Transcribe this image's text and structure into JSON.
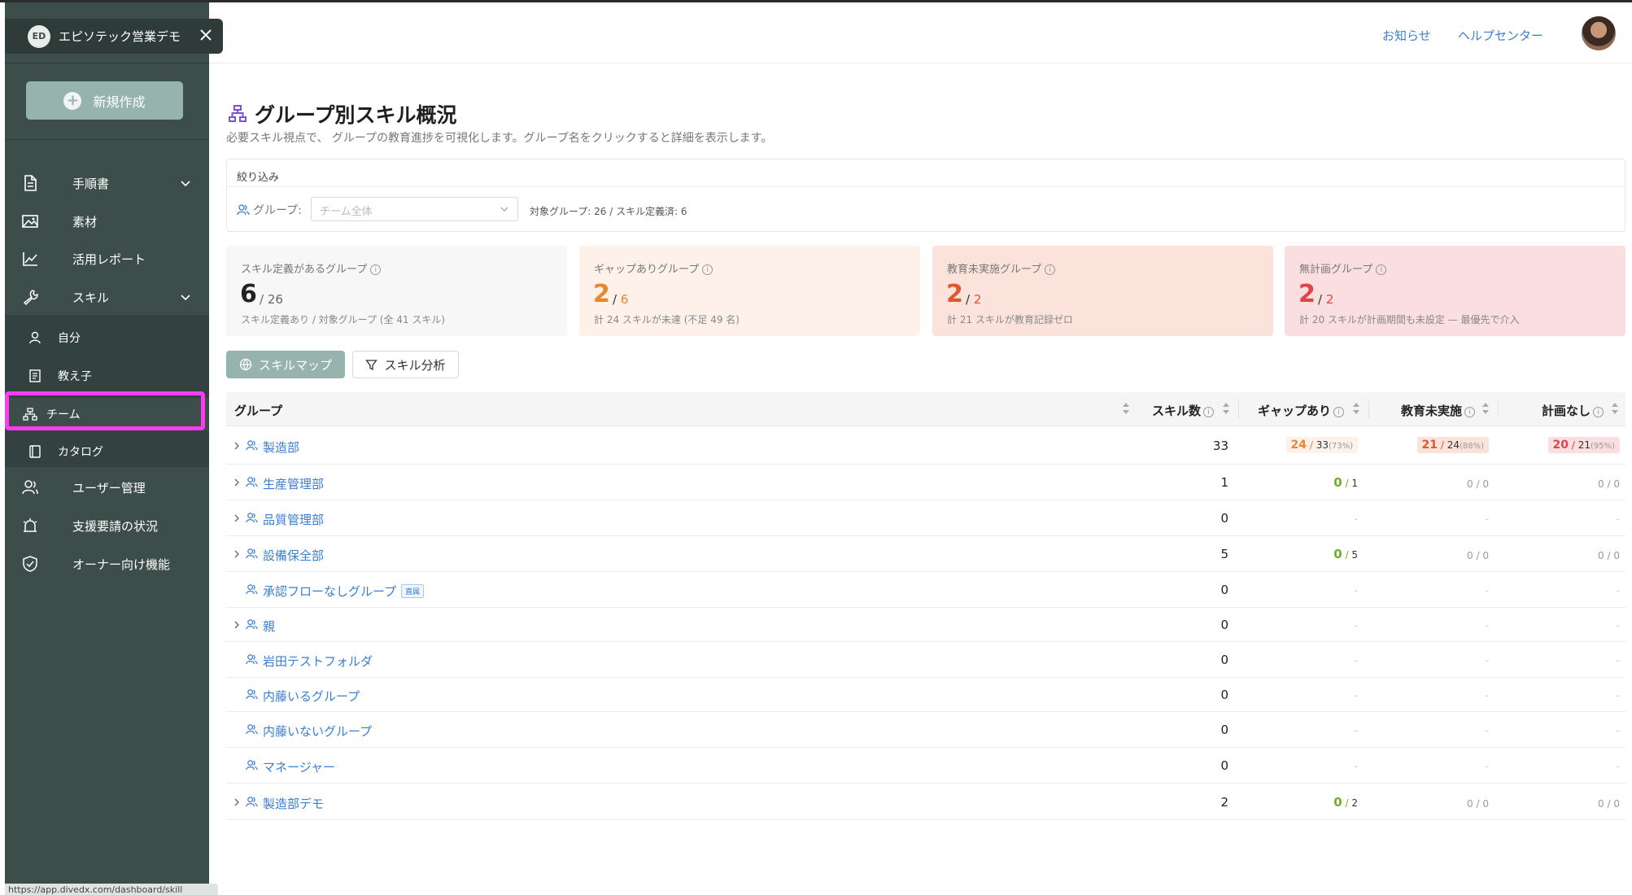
{
  "sidebar": {
    "org_name": "エピソテック営業デモ",
    "new_button": "新規作成",
    "items": [
      {
        "label": "手順書",
        "icon": "document-icon"
      },
      {
        "label": "素材",
        "icon": "image-icon"
      },
      {
        "label": "活用レポート",
        "icon": "chart-icon"
      },
      {
        "label": "スキル",
        "icon": "wrench-icon"
      },
      {
        "label": "ユーザー管理",
        "icon": "users-icon"
      },
      {
        "label": "支援要請の状況",
        "icon": "alarm-icon"
      },
      {
        "label": "オーナー向け機能",
        "icon": "shield-icon"
      }
    ],
    "skill_sub": [
      {
        "label": "自分",
        "icon": "user-icon"
      },
      {
        "label": "教え子",
        "icon": "book-icon"
      },
      {
        "label": "チーム",
        "icon": "org-icon"
      },
      {
        "label": "カタログ",
        "icon": "catalog-icon"
      }
    ],
    "url": "https://app.divedx.com/dashboard/skill"
  },
  "header": {
    "news": "お知らせ",
    "help": "ヘルプセンター"
  },
  "page": {
    "title": "グループ別スキル概況",
    "subtitle": "必要スキル視点で、 グループの教育進捗を可視化します。グループ名をクリックすると詳細を表示します。"
  },
  "filter": {
    "title": "絞り込み",
    "group_label": "グループ:",
    "group_placeholder": "チーム全体",
    "meta": "対象グループ: 26 / スキル定義済: 6"
  },
  "cards": [
    {
      "title": "スキル定義があるグループ",
      "value": "6",
      "total": "26",
      "note": "スキル定義あり / 対象グループ (全 41 スキル)",
      "color": "#222222",
      "bg": "#f7f7f7"
    },
    {
      "title": "ギャップありグループ",
      "value": "2",
      "total": "6",
      "note": "計 24 スキルが未達 (不足 49 名)",
      "color": "#e8862a",
      "bg": "#fdf1ea"
    },
    {
      "title": "教育未実施グループ",
      "value": "2",
      "total": "2",
      "note": "計 21 スキルが教育記録ゼロ",
      "color": "#e2562f",
      "bg": "#fbe3dc"
    },
    {
      "title": "無計画グループ",
      "value": "2",
      "total": "2",
      "note": "計 20 スキルが計画期間も未設定 — 最優先で介入",
      "color": "#e0444b",
      "bg": "#fbdedf"
    }
  ],
  "buttons": {
    "skill_map": "スキルマップ",
    "skill_analysis": "スキル分析"
  },
  "table": {
    "headers": {
      "group": "グループ",
      "skills": "スキル数",
      "gap": "ギャップあり",
      "untrained": "教育未実施",
      "unplanned": "計画なし"
    },
    "rows": [
      {
        "name": "製造部",
        "expandable": true,
        "tag": "",
        "skills": "33",
        "gap": {
          "type": "pill",
          "v": "24",
          "d": "33",
          "p": "(73%)",
          "color": "#e8862a",
          "bg": "#fdf1ea"
        },
        "untrained": {
          "type": "pill",
          "v": "21",
          "d": "24",
          "p": "(88%)",
          "color": "#e2562f",
          "bg": "#fbe3dc"
        },
        "unplanned": {
          "type": "pill",
          "v": "20",
          "d": "21",
          "p": "(95%)",
          "color": "#e0444b",
          "bg": "#fbdedf"
        }
      },
      {
        "name": "生産管理部",
        "expandable": true,
        "tag": "",
        "skills": "1",
        "gap": {
          "type": "green",
          "v": "0",
          "d": "1"
        },
        "untrained": {
          "type": "zero",
          "v": "0 / 0"
        },
        "unplanned": {
          "type": "zero",
          "v": "0 / 0"
        }
      },
      {
        "name": "品質管理部",
        "expandable": true,
        "tag": "",
        "skills": "0",
        "gap": {
          "type": "dash",
          "v": "-"
        },
        "untrained": {
          "type": "dash",
          "v": "-"
        },
        "unplanned": {
          "type": "dash",
          "v": "-"
        }
      },
      {
        "name": "設備保全部",
        "expandable": true,
        "tag": "",
        "skills": "5",
        "gap": {
          "type": "green",
          "v": "0",
          "d": "5"
        },
        "untrained": {
          "type": "zero",
          "v": "0 / 0"
        },
        "unplanned": {
          "type": "zero",
          "v": "0 / 0"
        }
      },
      {
        "name": "承認フローなしグループ",
        "expandable": false,
        "tag": "直属",
        "skills": "0",
        "gap": {
          "type": "dash",
          "v": "-"
        },
        "untrained": {
          "type": "dash",
          "v": "-"
        },
        "unplanned": {
          "type": "dash",
          "v": "-"
        }
      },
      {
        "name": "親",
        "expandable": true,
        "tag": "",
        "skills": "0",
        "gap": {
          "type": "dash",
          "v": "-"
        },
        "untrained": {
          "type": "dash",
          "v": "-"
        },
        "unplanned": {
          "type": "dash",
          "v": "-"
        }
      },
      {
        "name": "岩田テストフォルダ",
        "expandable": false,
        "tag": "",
        "skills": "0",
        "gap": {
          "type": "dash",
          "v": "-"
        },
        "untrained": {
          "type": "dash",
          "v": "-"
        },
        "unplanned": {
          "type": "dash",
          "v": "-"
        }
      },
      {
        "name": "内藤いるグループ",
        "expandable": false,
        "tag": "",
        "skills": "0",
        "gap": {
          "type": "dash",
          "v": "-"
        },
        "untrained": {
          "type": "dash",
          "v": "-"
        },
        "unplanned": {
          "type": "dash",
          "v": "-"
        }
      },
      {
        "name": "内藤いないグループ",
        "expandable": false,
        "tag": "",
        "skills": "0",
        "gap": {
          "type": "dash",
          "v": "-"
        },
        "untrained": {
          "type": "dash",
          "v": "-"
        },
        "unplanned": {
          "type": "dash",
          "v": "-"
        }
      },
      {
        "name": "マネージャー",
        "expandable": false,
        "tag": "",
        "skills": "0",
        "gap": {
          "type": "dash",
          "v": "-"
        },
        "untrained": {
          "type": "dash",
          "v": "-"
        },
        "unplanned": {
          "type": "dash",
          "v": "-"
        }
      },
      {
        "name": "製造部デモ",
        "expandable": true,
        "tag": "",
        "skills": "2",
        "gap": {
          "type": "green",
          "v": "0",
          "d": "2"
        },
        "untrained": {
          "type": "zero",
          "v": "0 / 0"
        },
        "unplanned": {
          "type": "zero",
          "v": "0 / 0"
        }
      }
    ]
  },
  "colors": {
    "accent": "#97b3ae",
    "link": "#3b7ed1",
    "sidebar": "#3d4d49",
    "highlight": "#ff3cf0",
    "green": "#6fae2e"
  }
}
